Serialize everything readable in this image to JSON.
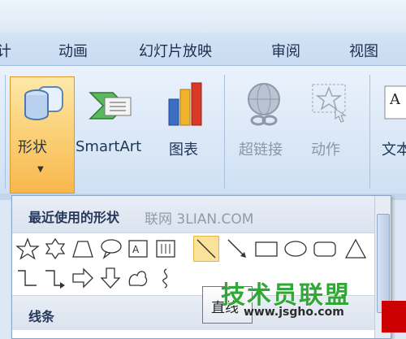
{
  "tabs": [
    "计",
    "动画",
    "幻灯片放映",
    "审阅",
    "视图"
  ],
  "ribbon": {
    "shape_label": "形状",
    "smartart_label": "SmartArt",
    "chart_label": "图表",
    "hyperlink_label": "超链接",
    "action_label": "动作",
    "text_label": "文本"
  },
  "gallery": {
    "recent_header": "最近使用的形状",
    "lines_header": "线条",
    "tooltip": "直线"
  },
  "watermark": "联网 3LIAN.COM",
  "logo": {
    "title": "技术员联盟",
    "url": "www.jsgho.com"
  },
  "colors": {
    "accent": "#f8b74d",
    "logo_green": "#30a835",
    "ribbon_bg": "#dce8f6"
  }
}
